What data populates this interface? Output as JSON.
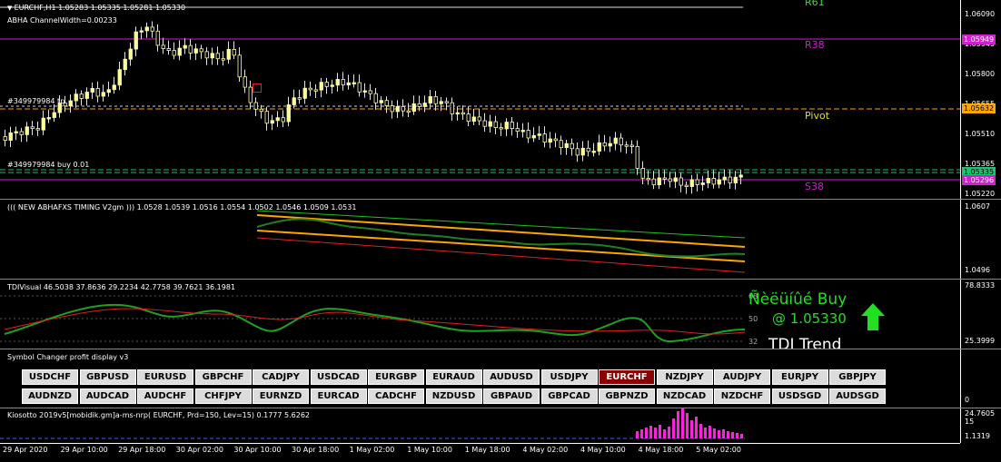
{
  "main_chart": {
    "title": "EURCHF,H1  1.05283 1.05335 1.05281 1.05330",
    "channel_label": "ABHA ChannelWidth=0.00233",
    "order_label_1": "#349979984 tp",
    "order_label_2": "#349979984 buy 0.01",
    "levels": {
      "r61": "R61",
      "r38": "R38",
      "pivot": "Pivot",
      "s38": "S38"
    },
    "price_axis": [
      "1.06090",
      "1.05945",
      "1.05800",
      "1.05655",
      "1.05510",
      "1.05365",
      "1.05220"
    ],
    "price_tags": {
      "r38": "1.05949",
      "pivot": "1.05632",
      "buy": "1.05335",
      "current": "1.05296"
    },
    "colors": {
      "r38": "#d020d0",
      "pivot": "#ffa500",
      "s38": "#d020d0",
      "candle": "#ffff99",
      "buy_line": "#20c070"
    }
  },
  "timing_pane": {
    "title": "((( NEW ABHAFXS TIMING V2gm ))) 1.0528 1.0539 1.0516 1.0554 1.0502 1.0546 1.0509 1.0531",
    "axis": [
      "1.0607",
      "1.0496"
    ]
  },
  "tdi_pane": {
    "title": "TDIVisual 46.5038 37.8636 29.2234 42.7758 39.7621 36.1981",
    "axis": [
      "78.8333",
      "25.3999"
    ],
    "levels": [
      "68",
      "50",
      "32"
    ],
    "signal_text": "Ñèëüíûé Buy",
    "signal_price": "@ 1.05330",
    "trend_text": "TDI Trend"
  },
  "symbol_changer": {
    "title": "Symbol Changer profit display v3",
    "row1": [
      "USDCHF",
      "GBPUSD",
      "EURUSD",
      "GBPCHF",
      "CADJPY",
      "USDCAD",
      "EURGBP",
      "EURAUD",
      "AUDUSD",
      "USDJPY",
      "EURCHF",
      "NZDJPY",
      "AUDJPY",
      "EURJPY",
      "GBPJPY"
    ],
    "row2": [
      "AUDNZD",
      "AUDCAD",
      "AUDCHF",
      "CHFJPY",
      "EURNZD",
      "EURCAD",
      "CADCHF",
      "NZDUSD",
      "GBPAUD",
      "GBPCAD",
      "GBPNZD",
      "NZDCAD",
      "NZDCHF",
      "USDSGD",
      "AUDSGD"
    ],
    "active": "EURCHF",
    "axis": [
      "0"
    ]
  },
  "kiosotto_pane": {
    "title": "Kiosotto 2019v5[mobidik.gm]a-ms-nrp( EURCHF, Prd=150, Lev=15) 0.1777 5.6262",
    "axis": [
      "24.7605",
      "15",
      "1.1319"
    ]
  },
  "time_axis": [
    "29 Apr 2020",
    "29 Apr 10:00",
    "29 Apr 18:00",
    "30 Apr 02:00",
    "30 Apr 10:00",
    "30 Apr 18:00",
    "1 May 02:00",
    "1 May 10:00",
    "1 May 18:00",
    "4 May 02:00",
    "4 May 10:00",
    "4 May 18:00",
    "5 May 02:00"
  ]
}
